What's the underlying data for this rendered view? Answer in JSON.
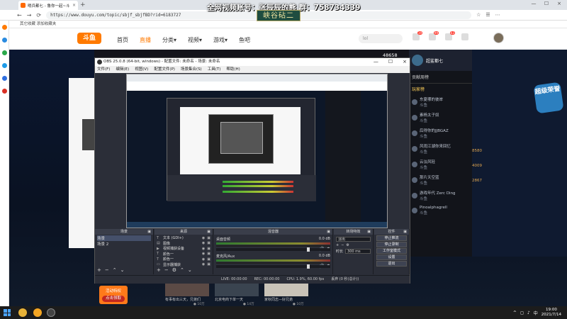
{
  "browser": {
    "tab_title": "哨兵都七 - 鲁你一起~斗鱼·每个...",
    "tab_close": "×",
    "new_tab": "+",
    "url": "https://www.douyu.com/topic/sbjf_sbjfBD?rid=6183727",
    "bookmark": "其它收藏  添加收藏夹",
    "window_buttons": [
      "—",
      "☐",
      "×"
    ],
    "address_right": [
      "☆",
      "☰",
      "⋯"
    ],
    "nav_buttons": [
      "←",
      "→",
      "⟳"
    ]
  },
  "overlay": {
    "title": "全网视频账号：张辰辰的熊  群：758734339",
    "subtitle": "峡谷砧二"
  },
  "douyu": {
    "logo": "斗鱼",
    "nav": [
      "首页",
      "直播",
      "分类▾",
      "视频▾",
      "游戏▾",
      "鱼吧"
    ],
    "search_placeholder": "lol",
    "header_badges": [
      "19",
      "99",
      "63"
    ],
    "popularity": "48658"
  },
  "chat": {
    "header_name": "超鲨都七",
    "tab": "贡献周榜",
    "sub_tab": "玩家榜",
    "rows": [
      {
        "name": "东夏哪的彼岸",
        "sub": "斗鱼"
      },
      {
        "name": "素杨太子奴",
        "sub": "斗鱼"
      },
      {
        "name": "后得你的JJBGAZ",
        "sub": "斗鱼"
      },
      {
        "name": "风雨江湖你来回忆",
        "sub": "斗鱼"
      },
      {
        "name": "云淡风轻",
        "sub": "斗鱼"
      },
      {
        "name": "那片天空蓝",
        "sub": "斗鱼"
      },
      {
        "name": "游戏年代 Zerc Ding",
        "sub": "斗鱼"
      },
      {
        "name": "Pinoalphagrell",
        "sub": "斗鱼"
      }
    ],
    "promo": "超级荣誉",
    "side_numbers": [
      "8580",
      "4009",
      "2867"
    ]
  },
  "bottom": {
    "hot_label": "活动特权",
    "hot_btn": "点击领取",
    "thumbs": [
      {
        "caption": "有事有出三天，兄弟们",
        "sub": "● 10万"
      },
      {
        "caption": "北京电商下单一天",
        "sub": "● 14万"
      },
      {
        "caption": "家秋同志—好兄弟",
        "sub": "● 10万"
      }
    ]
  },
  "obs": {
    "title": "OBS 25.0.8 (64-bit, windows) - 配置文件: 未命名 - 场景: 未命名",
    "menu": [
      "文件(F)",
      "编辑(E)",
      "视图(V)",
      "配置文件(P)",
      "场景集合(S)",
      "工具(T)",
      "帮助(H)"
    ],
    "window_buttons": [
      "—",
      "☐",
      "×"
    ],
    "docks": {
      "scenes_title": "场景",
      "scenes": [
        "场景",
        "场景 2"
      ],
      "sources_title": "来源",
      "sources": [
        "文本 (GDI+)",
        "图像",
        "视频捕获设备",
        "颜色一",
        "颜色一",
        "显示器捕获"
      ],
      "mixer_title": "混音器",
      "mixer": [
        {
          "name": "桌面音频",
          "db": "0.0 dB"
        },
        {
          "name": "麦克风/Aux",
          "db": "0.0 dB"
        }
      ],
      "transitions_title": "转场特效",
      "transition_value": "淡出",
      "duration_label": "时长",
      "duration_value": "300 ms",
      "controls_title": "控件",
      "controls": [
        "停止推流",
        "停止录制",
        "工作室模式",
        "设置",
        "退出"
      ]
    },
    "status": {
      "live": "LIVE: 00:00:00",
      "rec": "REC: 00:00:00",
      "cpu": "CPU: 1.9%, 60.00 fps",
      "delay": "丢弃 (0 秒(总计))"
    }
  },
  "taskbar": {
    "time": "19:00",
    "date": "2021/7/14",
    "tray": [
      "^",
      "◻",
      "♪",
      "中"
    ]
  }
}
